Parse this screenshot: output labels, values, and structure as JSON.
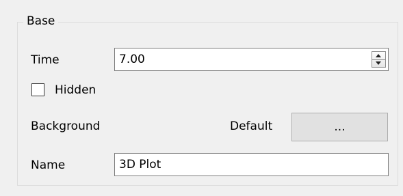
{
  "group": {
    "title": "Base"
  },
  "time": {
    "label": "Time",
    "value": "7.00"
  },
  "hidden": {
    "label": "Hidden",
    "checked": false
  },
  "background": {
    "label": "Background",
    "mode": "Default",
    "button_label": "..."
  },
  "name": {
    "label": "Name",
    "value": "3D Plot"
  }
}
